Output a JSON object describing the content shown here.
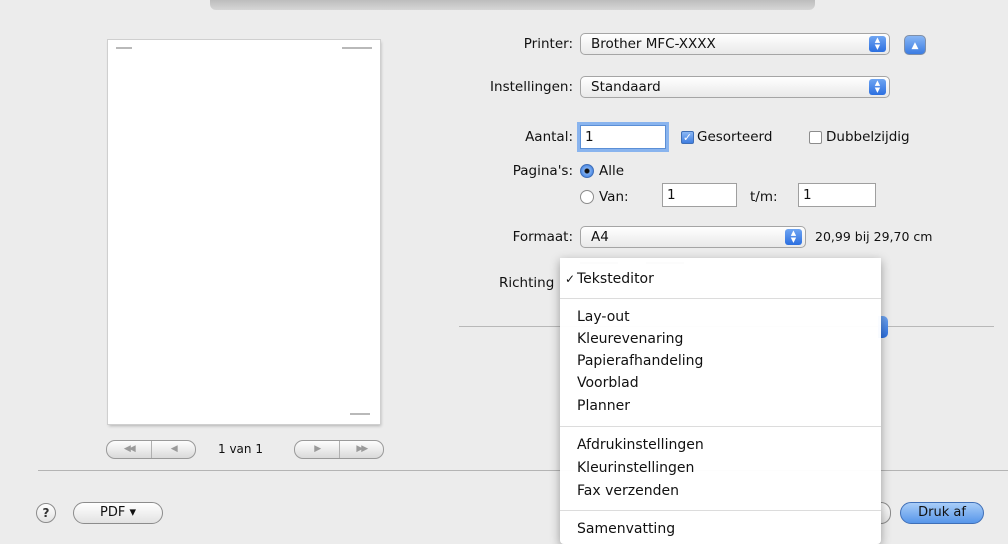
{
  "printer": {
    "label": "Printer:",
    "value": "Brother MFC-XXXX"
  },
  "presets": {
    "label": "Instellingen:",
    "value": "Standaard"
  },
  "copies": {
    "label": "Aantal:",
    "value": "1",
    "collated_label": "Gesorteerd",
    "collated": true,
    "two_sided_label": "Dubbelzijdig",
    "two_sided": false
  },
  "pages": {
    "label": "Pagina's:",
    "all_label": "Alle",
    "from_label": "Van:",
    "from_value": "1",
    "to_label": "t/m:",
    "to_value": "1",
    "selected": "all"
  },
  "paper_size": {
    "label": "Formaat:",
    "value": "A4",
    "dimensions": "20,99 bij 29,70 cm"
  },
  "orientation": {
    "label": "Richting"
  },
  "preview": {
    "page_indicator": "1 van 1",
    "first": "◀◀",
    "prev": "◀",
    "next": "▶",
    "last": "▶▶"
  },
  "menu": {
    "checked_item": "Teksteditor",
    "groups": [
      [
        "Teksteditor"
      ],
      [
        "Lay-out",
        "Kleurevenaring",
        "Papierafhandeling",
        "Voorblad",
        "Planner"
      ],
      [
        "Afdrukinstellingen",
        "Kleurinstellingen",
        "Fax verzenden"
      ],
      [
        "Samenvatting"
      ]
    ]
  },
  "footer": {
    "help": "?",
    "pdf": "PDF ▾",
    "print": "Druk af"
  },
  "icons": {
    "help": "question-icon",
    "stepper": "updown-arrows-icon",
    "disclosure": "triangle-up-icon"
  },
  "colors": {
    "accent": "#3b7ce3",
    "background": "#ececec"
  }
}
